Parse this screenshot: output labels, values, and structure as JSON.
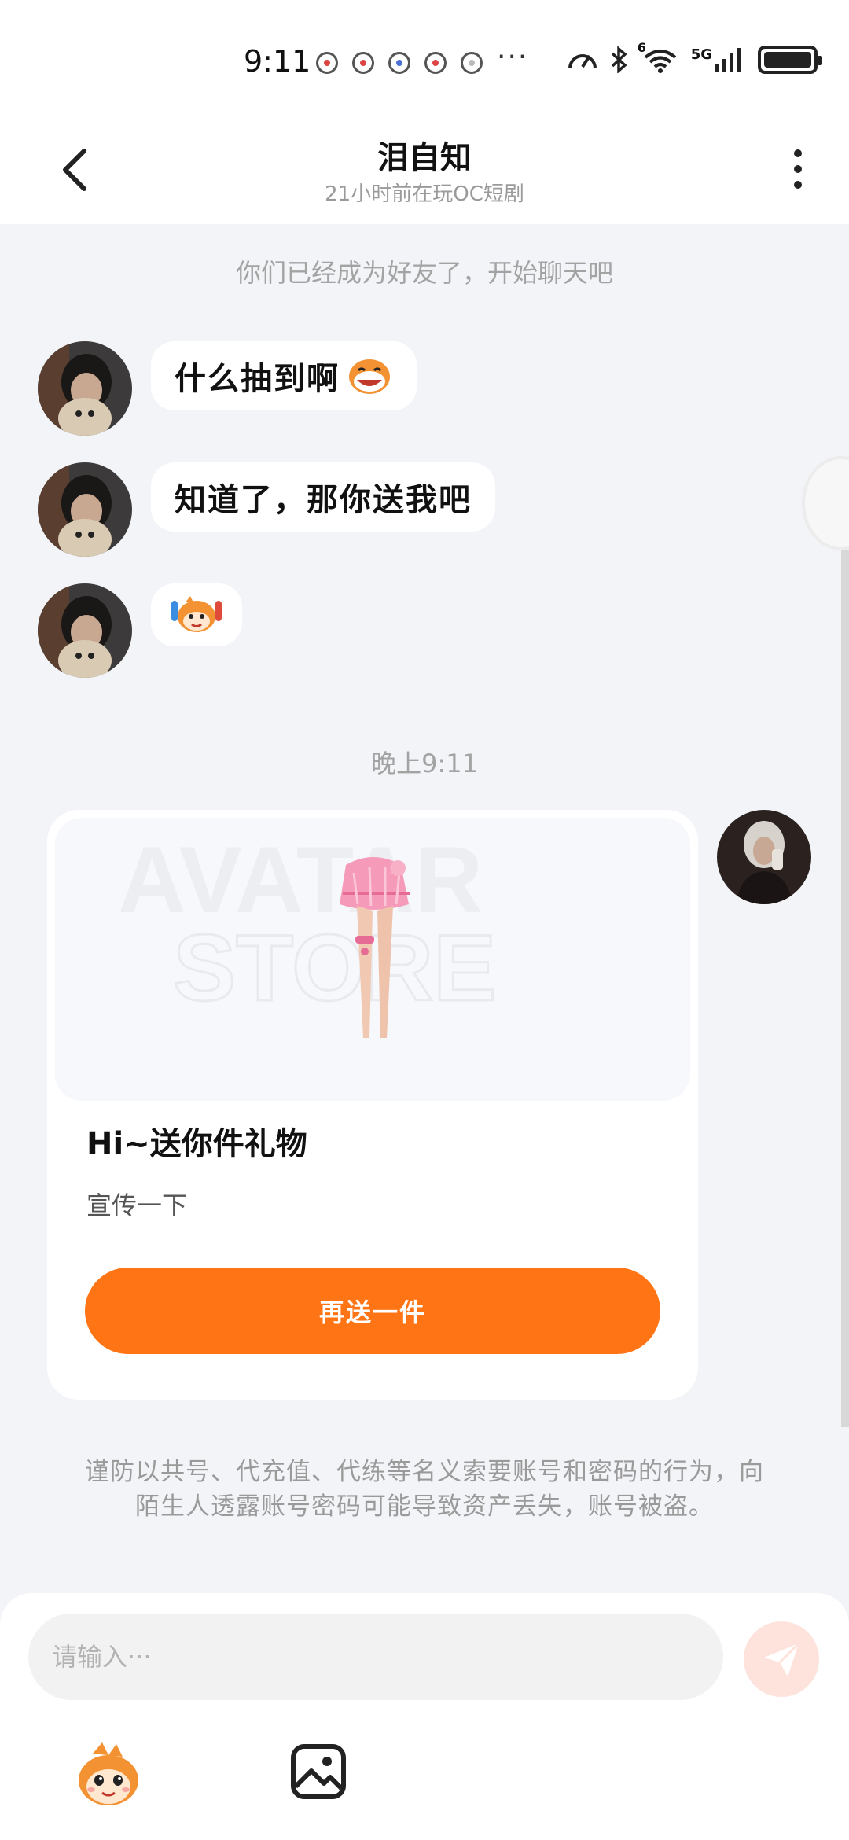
{
  "status_bar": {
    "time": "9:11",
    "more": "···",
    "network": "5G",
    "wifi_badge": "6"
  },
  "header": {
    "title": "泪自知",
    "subtitle": "21小时前在玩OC短剧"
  },
  "chat": {
    "system_note": "你们已经成为好友了，开始聊天吧",
    "messages": [
      {
        "text": "什么抽到啊"
      },
      {
        "text": "知道了，那你送我吧"
      },
      {
        "text": ""
      }
    ],
    "time_note": "晚上9:11"
  },
  "gift_card": {
    "watermark_top": "AVATAR",
    "watermark_bottom": "STORE",
    "title": "Hi~送你件礼物",
    "description": "宣传一下",
    "button_label": "再送一件"
  },
  "warning": "谨防以共号、代充值、代练等名义索要账号和密码的行为，向陌生人透露账号密码可能导致资产丢失，账号被盗。",
  "input": {
    "placeholder": "请输入···",
    "value": ""
  },
  "colors": {
    "accent": "#ff7414",
    "background": "#f2f4f7",
    "bubble": "#ffffff",
    "muted_text": "#a3a3a3"
  },
  "icons": {
    "back": "chevron-left-icon",
    "more": "more-vertical-icon",
    "send": "send-icon",
    "emoji": "monkey-emoji-icon",
    "image": "image-icon"
  }
}
